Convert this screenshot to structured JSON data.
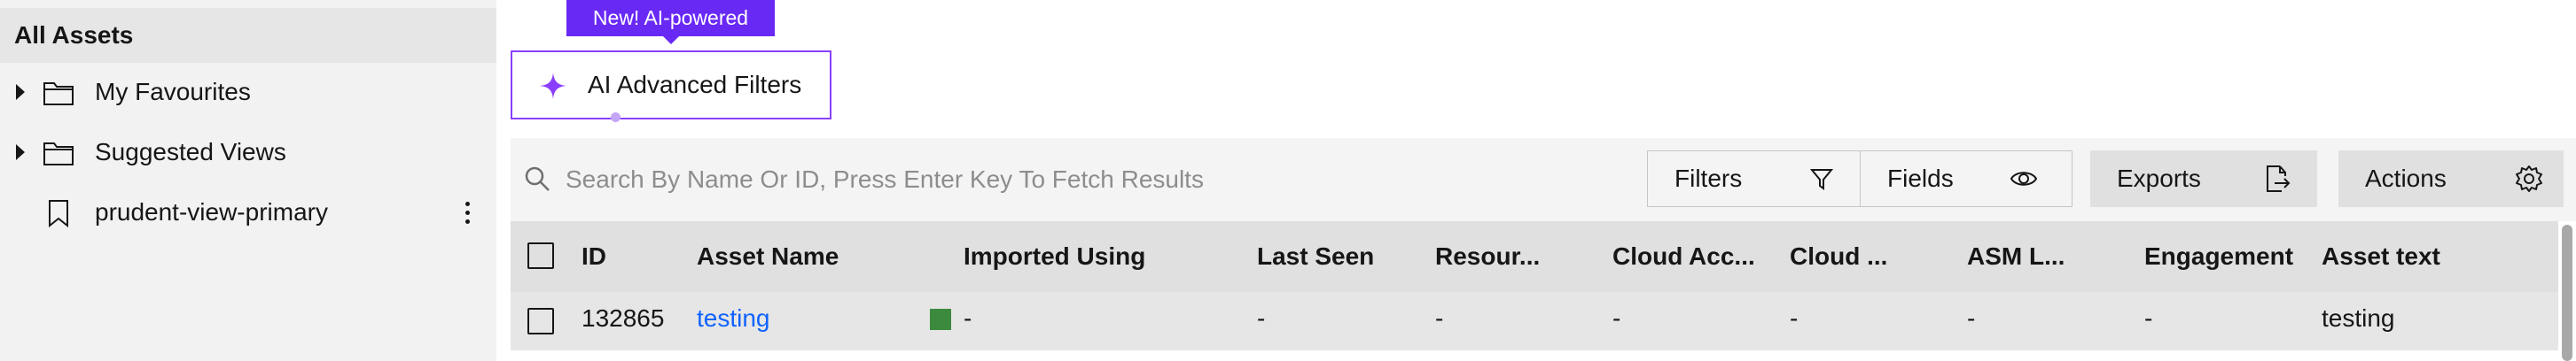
{
  "sidebar": {
    "header": "All Assets",
    "items": [
      {
        "label": "My Favourites",
        "icon": "folder-icon"
      },
      {
        "label": "Suggested Views",
        "icon": "folder-icon"
      },
      {
        "label": "prudent-view-primary",
        "icon": "bookmark-icon"
      }
    ]
  },
  "ai_filter": {
    "badge": "New! AI-powered",
    "label": "AI Advanced Filters"
  },
  "toolbar": {
    "search_placeholder": "Search By Name Or ID, Press Enter Key To Fetch Results",
    "filters_label": "Filters",
    "fields_label": "Fields",
    "exports_label": "Exports",
    "actions_label": "Actions"
  },
  "table": {
    "columns": [
      "ID",
      "Asset Name",
      "Imported Using",
      "Last Seen",
      "Resour...",
      "Cloud Acc...",
      "Cloud ...",
      "ASM L...",
      "Engagement",
      "Asset text"
    ],
    "rows": [
      {
        "id": "132865",
        "asset_name": "testing",
        "imported_using": "-",
        "last_seen": "-",
        "resource": "-",
        "cloud_account": "-",
        "cloud": "-",
        "asm": "-",
        "engagement": "-",
        "asset_text": "testing",
        "status_color": "#3c8a3e"
      }
    ]
  },
  "colors": {
    "accent": "#8a3ffc",
    "badge": "#6929f5",
    "link": "#0f62fe"
  }
}
